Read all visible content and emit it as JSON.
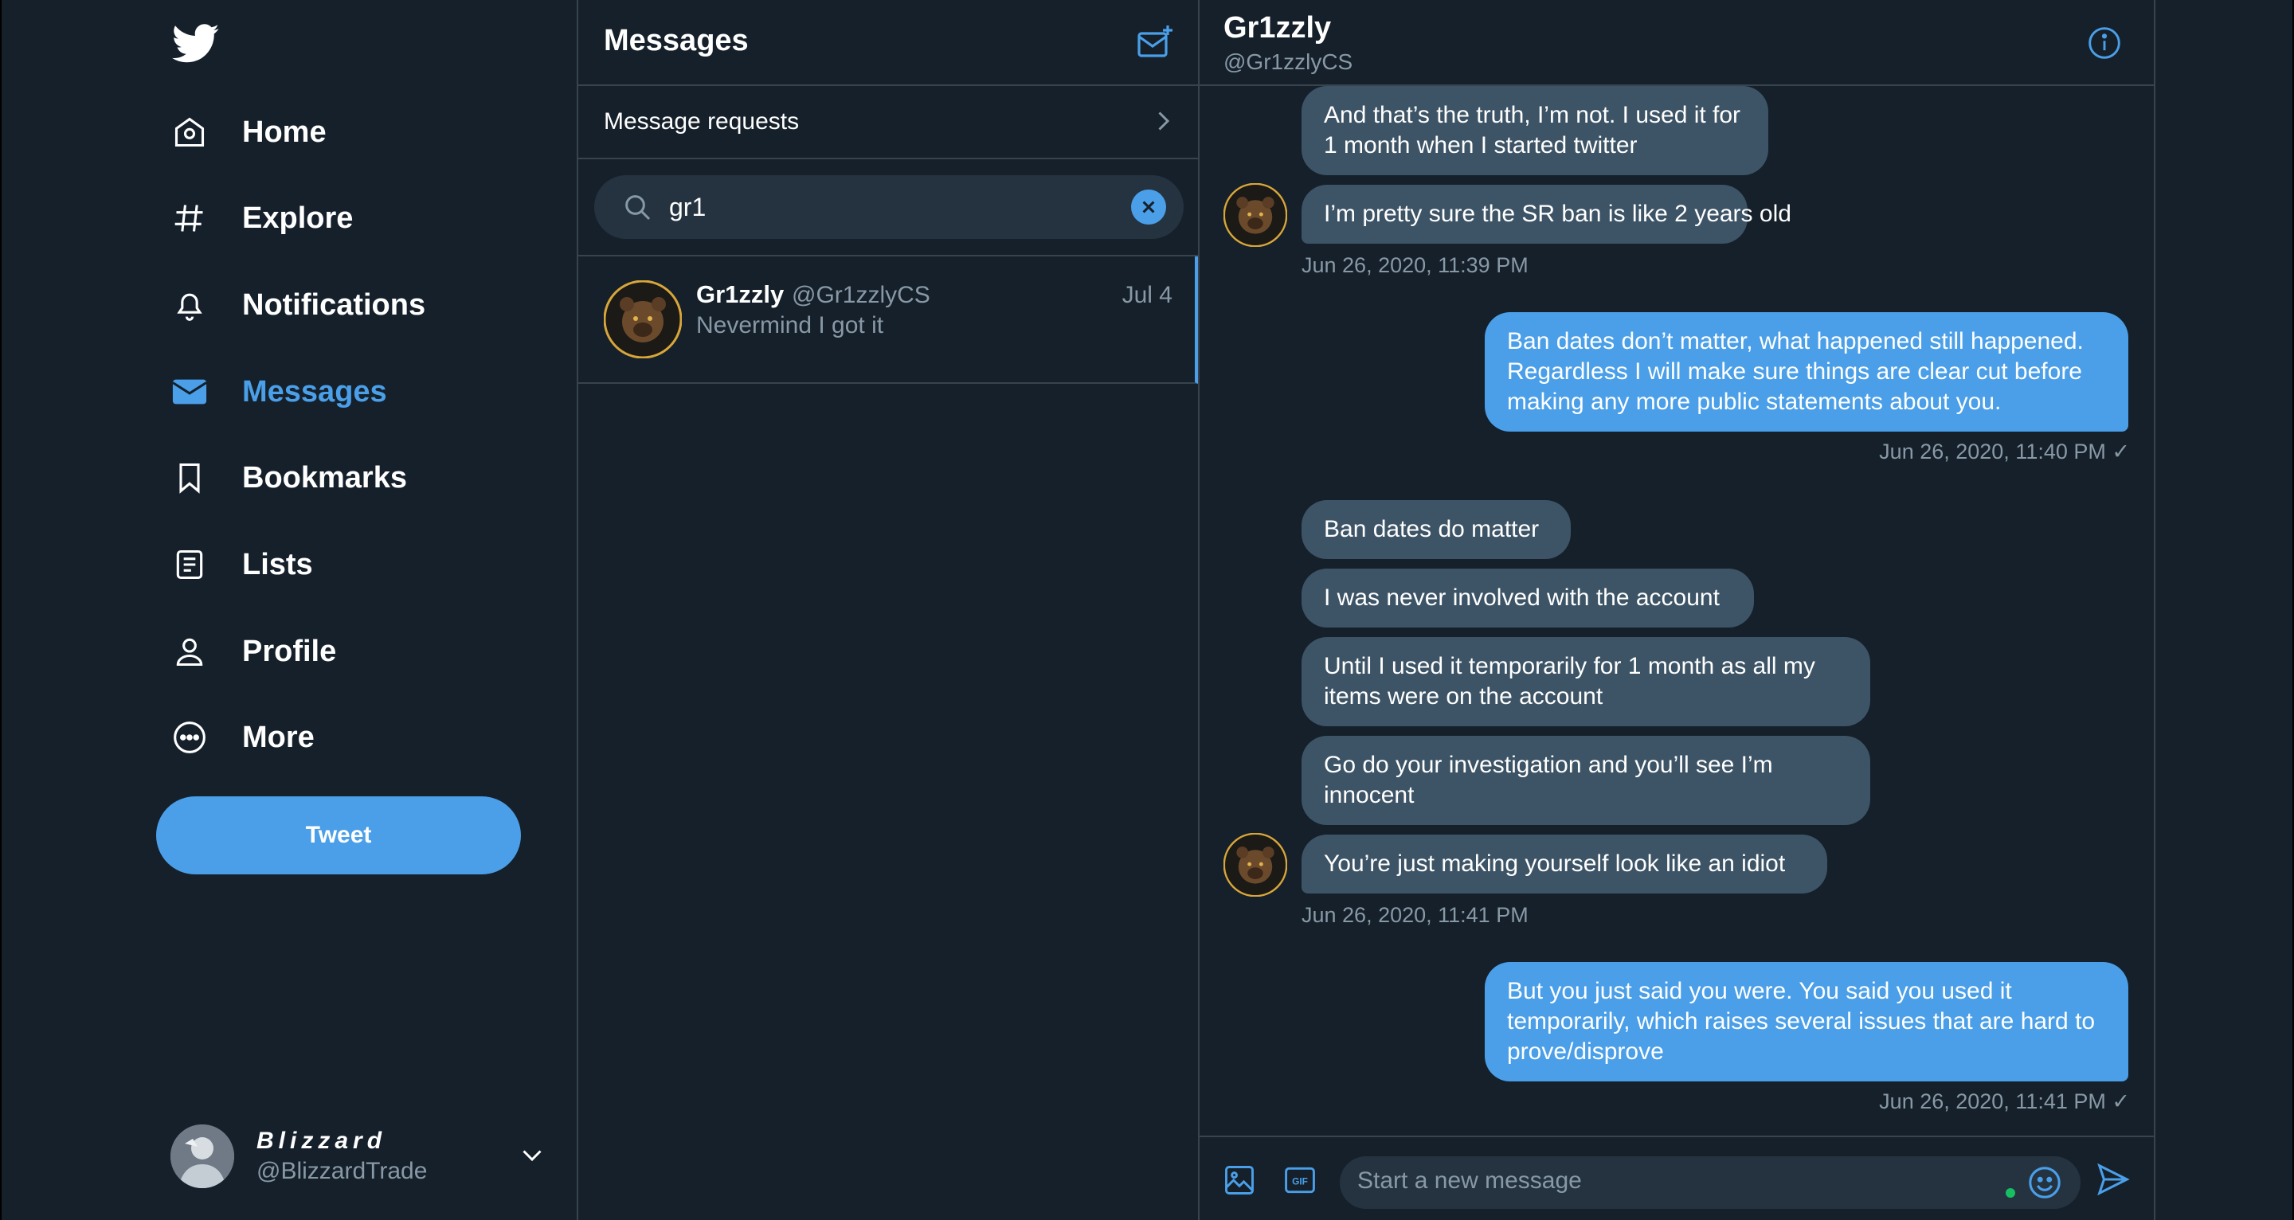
{
  "nav": {
    "items": [
      {
        "label": "Home",
        "icon": "home-icon"
      },
      {
        "label": "Explore",
        "icon": "hashtag-icon"
      },
      {
        "label": "Notifications",
        "icon": "bell-icon"
      },
      {
        "label": "Messages",
        "icon": "envelope-icon",
        "active": true
      },
      {
        "label": "Bookmarks",
        "icon": "bookmark-icon"
      },
      {
        "label": "Lists",
        "icon": "list-icon"
      },
      {
        "label": "Profile",
        "icon": "person-icon"
      },
      {
        "label": "More",
        "icon": "more-icon"
      }
    ],
    "tweet_label": "Tweet",
    "account": {
      "display_name": "Blizzard",
      "handle": "@BlizzardTrade"
    }
  },
  "messages": {
    "title": "Message s",
    "title_text": "Messages",
    "requests_label": "Message requests",
    "search_value": "gr1",
    "conversations": [
      {
        "name": "Gr1zzly",
        "handle": "@Gr1zzlyCS",
        "date": "Jul 4",
        "preview": "Nevermind I got it"
      }
    ]
  },
  "chat": {
    "name": "Gr1zzly",
    "handle": "@Gr1zzlyCS",
    "messages": [
      {
        "dir": "in",
        "text": "And that’s the truth, I’m not. I used it for 1 month when I started twitter"
      },
      {
        "dir": "in",
        "text": "I’m pretty sure the SR ban is like 2 years old"
      },
      {
        "dir": "out",
        "text": "Ban dates don’t matter, what happened still happened. Regardless I will make sure things are clear cut before making any more public statements about you."
      },
      {
        "dir": "in",
        "text": "Ban dates do matter"
      },
      {
        "dir": "in",
        "text": "I was never involved with the account"
      },
      {
        "dir": "in",
        "text": "Until I used it temporarily for 1 month as all my items were on the account"
      },
      {
        "dir": "in",
        "text": "Go do your investigation and you’ll see I’m innocent"
      },
      {
        "dir": "in",
        "text": "You’re just making yourself look like an idiot"
      },
      {
        "dir": "out",
        "text": "But you just said you were. You said you used it temporarily, which raises several issues that are hard to prove/disprove"
      }
    ],
    "timestamps": [
      "Jun 26, 2020, 11:39 PM",
      "Jun 26, 2020, 11:40 PM ✓",
      "Jun 26, 2020, 11:41 PM",
      "Jun 26, 2020, 11:41 PM ✓"
    ],
    "composer_placeholder": "Start a new message",
    "gif_label": "GIF"
  },
  "colors": {
    "accent": "#4a9fe8",
    "background": "#15202b",
    "bubble_in": "#3d5466",
    "muted": "#8899a6",
    "border": "#38444d"
  }
}
